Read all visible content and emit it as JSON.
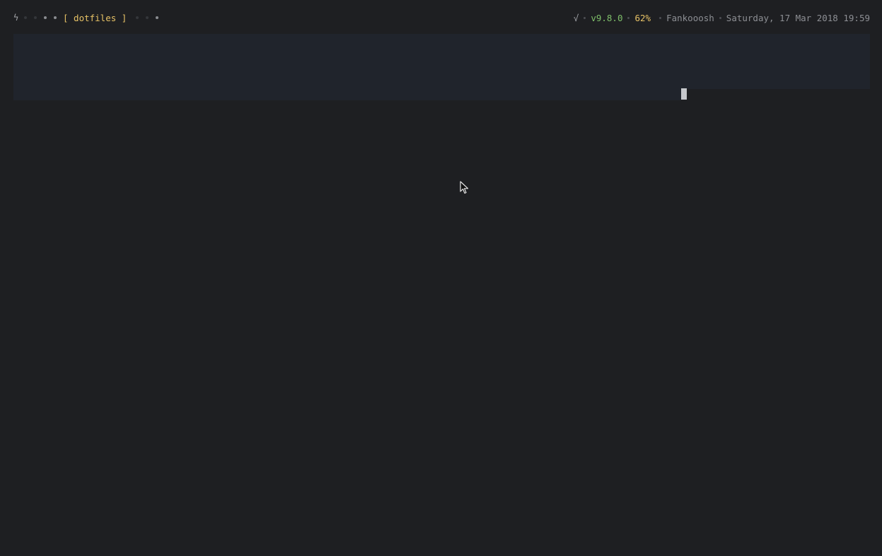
{
  "statusbar": {
    "left": {
      "icon": "bolt-icon",
      "workspace_label": "[ dotfiles ]"
    },
    "right": {
      "check_mark": "√",
      "version": "v9.8.0",
      "battery": "62%",
      "username": "Fankooosh",
      "datetime": "Saturday, 17 Mar 2018 19:59"
    }
  },
  "colors": {
    "background": "#1e1f22",
    "banner": "#20242c",
    "accent_yellow": "#e7c266",
    "accent_green": "#7fbf6a"
  }
}
